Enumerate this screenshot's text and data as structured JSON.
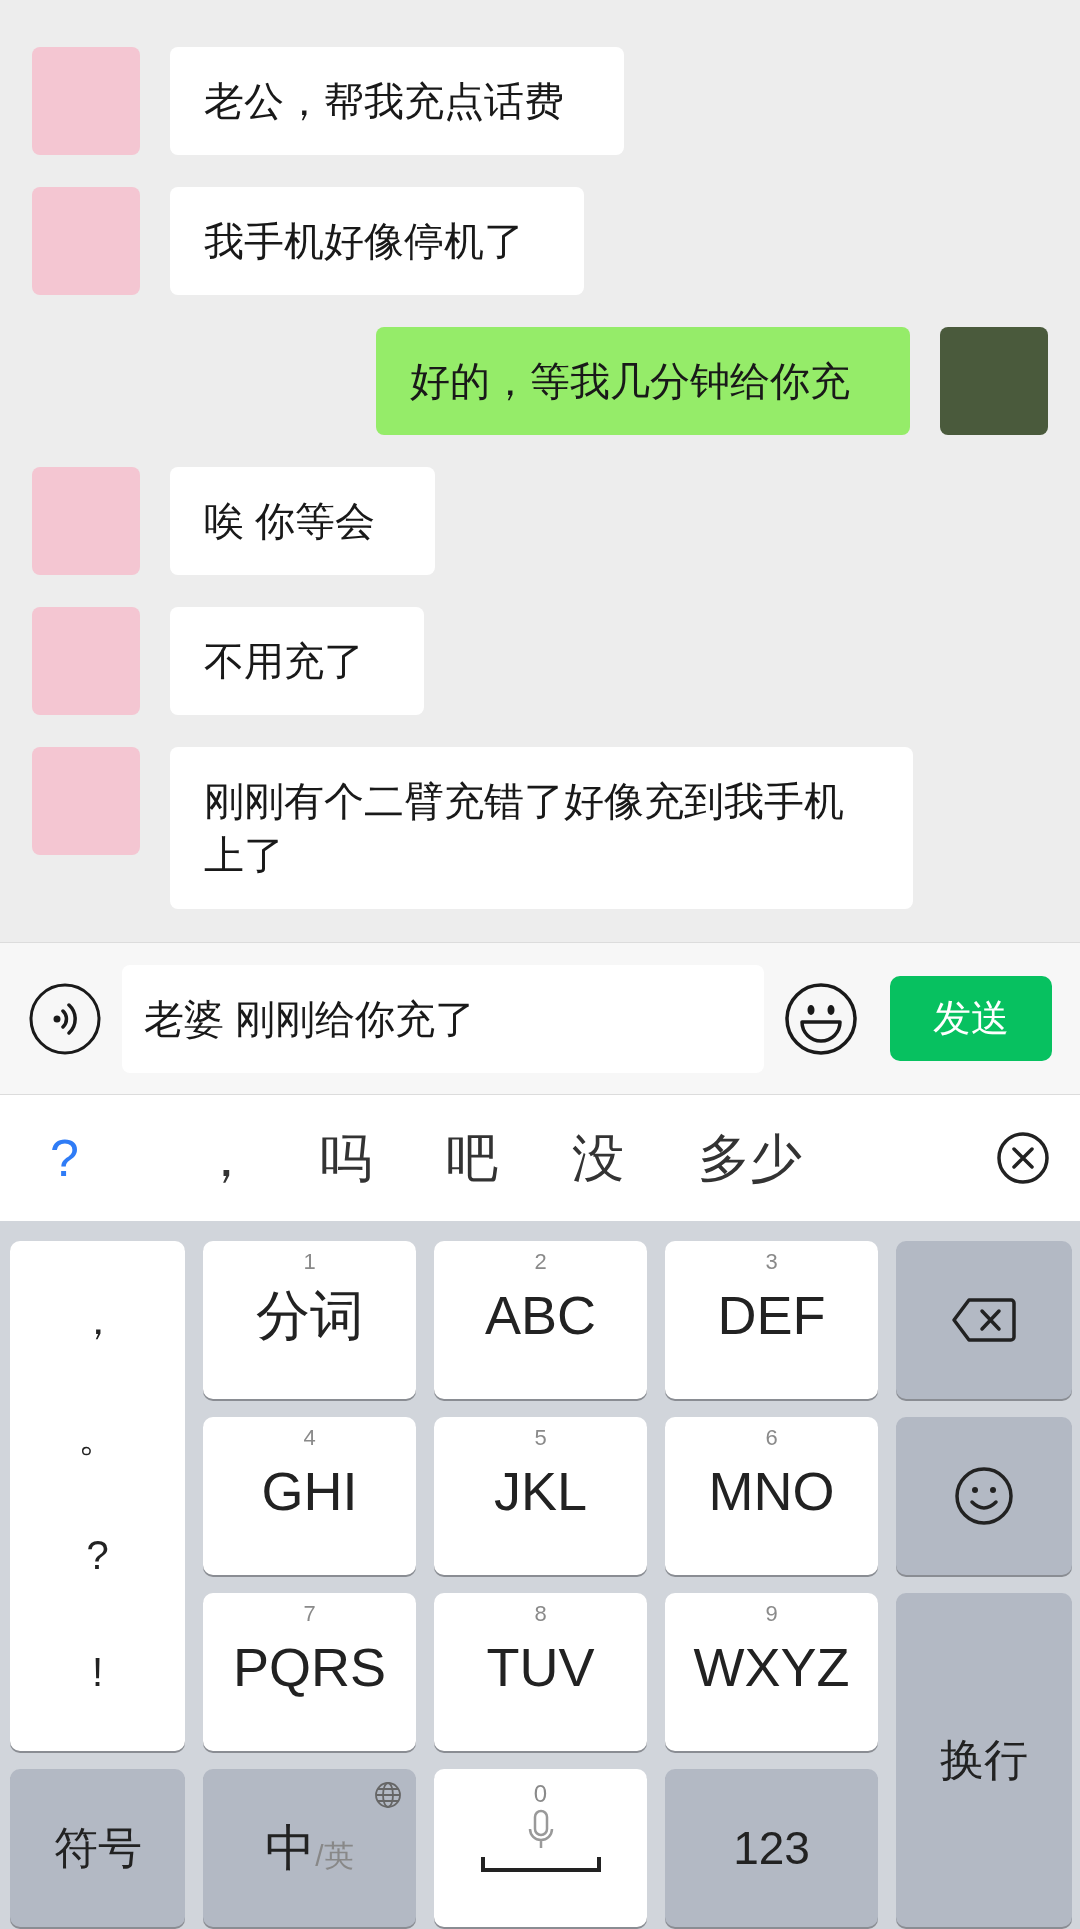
{
  "messages": [
    {
      "kind": "incoming",
      "text": "老公，帮我充点话费"
    },
    {
      "kind": "incoming",
      "text": "我手机好像停机了"
    },
    {
      "kind": "outgoing",
      "text": "好的，等我几分钟给你充"
    },
    {
      "kind": "incoming",
      "text": "唉 你等会"
    },
    {
      "kind": "incoming",
      "text": "不用充了"
    },
    {
      "kind": "incoming",
      "text": "刚刚有个二臂充错了好像充到我手机上了"
    }
  ],
  "input_bar": {
    "value": "老婆 刚刚给你充了",
    "send": "发送"
  },
  "candidates": [
    {
      "text": "?",
      "kind": "symbol"
    },
    {
      "text": "，",
      "kind": "word"
    },
    {
      "text": "吗",
      "kind": "word"
    },
    {
      "text": "吧",
      "kind": "word"
    },
    {
      "text": "没",
      "kind": "word"
    },
    {
      "text": "多少",
      "kind": "word"
    }
  ],
  "keyboard": {
    "punctuation": [
      "，",
      "。",
      "?",
      "!"
    ],
    "keys": [
      {
        "digit": "1",
        "label": "分词"
      },
      {
        "digit": "2",
        "label": "ABC"
      },
      {
        "digit": "3",
        "label": "DEF"
      },
      {
        "digit": "4",
        "label": "GHI"
      },
      {
        "digit": "5",
        "label": "JKL"
      },
      {
        "digit": "6",
        "label": "MNO"
      },
      {
        "digit": "7",
        "label": "PQRS"
      },
      {
        "digit": "8",
        "label": "TUV"
      },
      {
        "digit": "9",
        "label": "WXYZ"
      }
    ],
    "symbols": "符号",
    "lang": "中",
    "lang_alt": "/英",
    "space_digit": "0",
    "numbers": "123",
    "return": "换行"
  }
}
